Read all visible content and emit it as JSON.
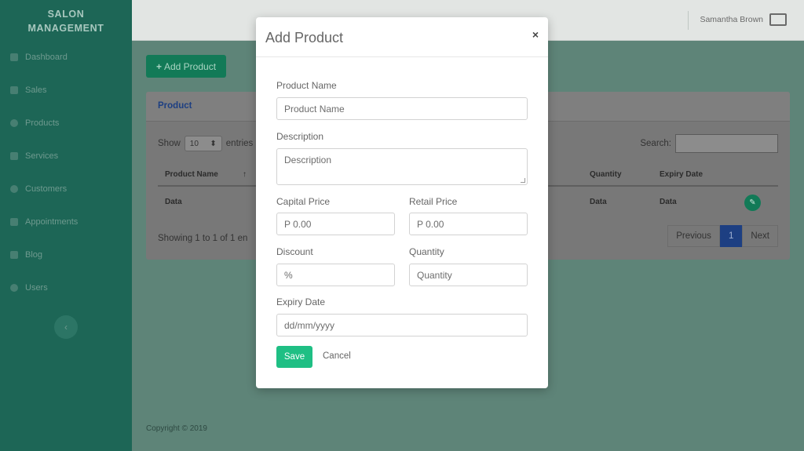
{
  "sidebar": {
    "brand_line1": "SALON",
    "brand_line2": "MANAGEMENT",
    "items": [
      {
        "label": "Dashboard",
        "icon": "dashboard-icon"
      },
      {
        "label": "Sales",
        "icon": "sales-icon"
      },
      {
        "label": "Products",
        "icon": "products-icon"
      },
      {
        "label": "Services",
        "icon": "services-icon"
      },
      {
        "label": "Customers",
        "icon": "customers-icon"
      },
      {
        "label": "Appointments",
        "icon": "appointments-icon"
      },
      {
        "label": "Blog",
        "icon": "blog-icon"
      },
      {
        "label": "Users",
        "icon": "users-icon"
      }
    ],
    "collapse_glyph": "‹"
  },
  "topbar": {
    "user_name": "Samantha Brown"
  },
  "main": {
    "add_button_label": "Add Product",
    "card_title": "Product",
    "show_label": "Show",
    "entries_value": "10",
    "entries_label": "entries",
    "search_label": "Search:",
    "columns": {
      "product_name": "Product Name",
      "quantity": "Quantity",
      "expiry_date": "Expiry Date"
    },
    "row": {
      "product_name": "Data",
      "quantity": "Data",
      "expiry_date": "Data"
    },
    "showing_text": "Showing 1 to 1 of 1 en",
    "pager": {
      "previous": "Previous",
      "page": "1",
      "next": "Next"
    },
    "copyright": "Copyright © 2019"
  },
  "modal": {
    "title": "Add Product",
    "close_glyph": "×",
    "fields": {
      "product_name": {
        "label": "Product Name",
        "placeholder": "Product Name"
      },
      "description": {
        "label": "Description",
        "placeholder": "Description"
      },
      "capital_price": {
        "label": "Capital Price",
        "placeholder": "P 0.00"
      },
      "retail_price": {
        "label": "Retail Price",
        "placeholder": "P 0.00"
      },
      "discount": {
        "label": "Discount",
        "placeholder": "%"
      },
      "quantity": {
        "label": "Quantity",
        "placeholder": "Quantity"
      },
      "expiry_date": {
        "label": "Expiry Date",
        "placeholder": "dd/mm/yyyy"
      }
    },
    "save_label": "Save",
    "cancel_label": "Cancel"
  },
  "colors": {
    "sidebar": "#1d6656",
    "accent_green": "#1fbf84",
    "pagination_active": "#1d3f82",
    "modal_bg": "#ffffff"
  }
}
